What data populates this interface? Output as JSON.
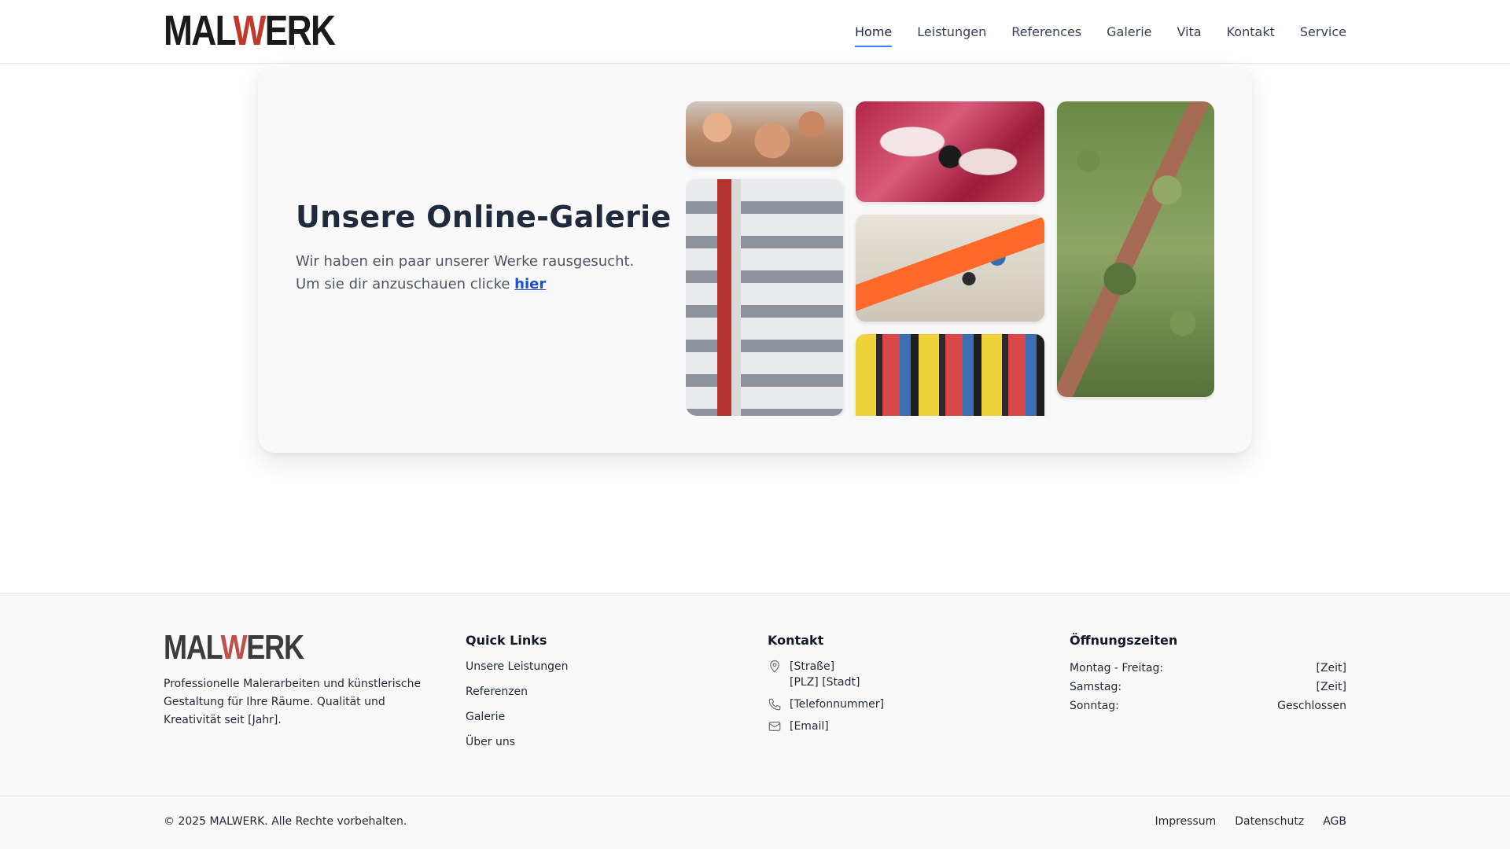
{
  "brand": {
    "logo_left": "MAL",
    "logo_w": "W",
    "logo_right": "ERK",
    "accent": "#c0392b"
  },
  "nav": {
    "items": [
      "Home",
      "Leistungen",
      "References",
      "Galerie",
      "Vita",
      "Kontakt",
      "Service"
    ],
    "active": "Home"
  },
  "hero": {
    "title": "Unsere Online-Galerie",
    "line1": "Wir haben ein paar unserer Werke rausgesucht.",
    "line2": "Um sie dir anzuschauen clicke",
    "link": "hier"
  },
  "gallery": {
    "images": [
      "ceiling-fresco",
      "rocket-mural",
      "red-abstract-painting",
      "paint-supplies",
      "colorful-city-painting",
      "tree-painting"
    ]
  },
  "footer": {
    "description": "Professionelle Malerarbeiten und künstlerische Gestaltung für Ihre Räume. Qualität und Kreativität seit [Jahr].",
    "quick_links_title": "Quick Links",
    "quick_links": [
      "Unsere Leistungen",
      "Referenzen",
      "Galerie",
      "Über uns"
    ],
    "contact_title": "Kontakt",
    "contact": {
      "street": "[Straße]",
      "city": "[PLZ] [Stadt]",
      "phone": "[Telefonnummer]",
      "email": "[Email]"
    },
    "hours_title": "Öffnungszeiten",
    "hours": [
      {
        "day": "Montag - Freitag:",
        "time": "[Zeit]"
      },
      {
        "day": "Samstag:",
        "time": "[Zeit]"
      },
      {
        "day": "Sonntag:",
        "time": "Geschlossen"
      }
    ],
    "copyright": "© 2025 MALWERK. Alle Rechte vorbehalten.",
    "legal": [
      "Impressum",
      "Datenschutz",
      "AGB"
    ]
  }
}
